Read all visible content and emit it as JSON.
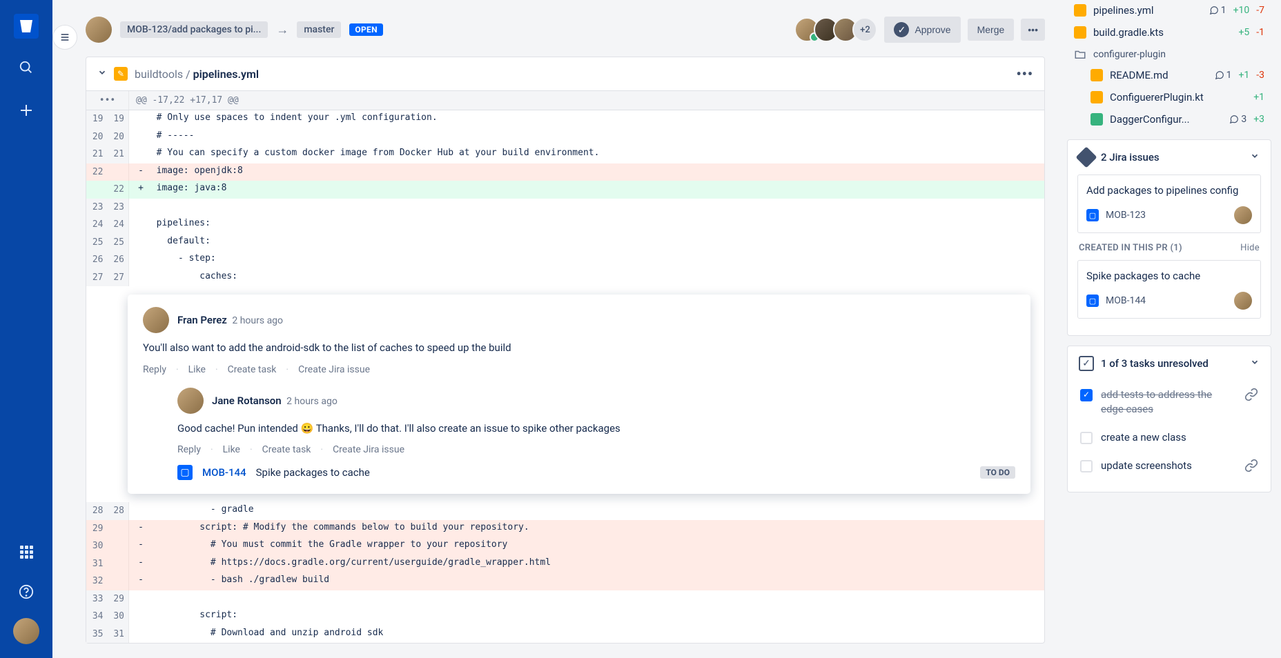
{
  "header": {
    "source_branch": "MOB-123/add packages to pi...",
    "target_branch": "master",
    "status": "OPEN",
    "overflow_count": "+2",
    "approve_label": "Approve",
    "merge_label": "Merge"
  },
  "file": {
    "path_prefix": "buildtools / ",
    "filename": "pipelines.yml",
    "hunk": "@@ -17,22 +17,17 @@"
  },
  "diff_lines": [
    {
      "old": "19",
      "new": "19",
      "type": "",
      "text": "  # Only use spaces to indent your .yml configuration."
    },
    {
      "old": "20",
      "new": "20",
      "type": "",
      "text": "  # -----"
    },
    {
      "old": "21",
      "new": "21",
      "type": "",
      "text": "  # You can specify a custom docker image from Docker Hub at your build environment."
    },
    {
      "old": "22",
      "new": "",
      "type": "del",
      "text": "  image: openjdk:8"
    },
    {
      "old": "",
      "new": "22",
      "type": "add",
      "text": "  image: java:8"
    },
    {
      "old": "23",
      "new": "23",
      "type": "",
      "text": ""
    },
    {
      "old": "24",
      "new": "24",
      "type": "",
      "text": "  pipelines:"
    },
    {
      "old": "25",
      "new": "25",
      "type": "",
      "text": "    default:"
    },
    {
      "old": "26",
      "new": "26",
      "type": "",
      "text": "      - step:"
    },
    {
      "old": "27",
      "new": "27",
      "type": "",
      "text": "          caches:"
    }
  ],
  "diff_lines_after": [
    {
      "old": "28",
      "new": "28",
      "type": "",
      "text": "            - gradle"
    },
    {
      "old": "29",
      "new": "",
      "type": "del",
      "text": "          script: # Modify the commands below to build your repository."
    },
    {
      "old": "30",
      "new": "",
      "type": "del",
      "text": "            # You must commit the Gradle wrapper to your repository"
    },
    {
      "old": "31",
      "new": "",
      "type": "del",
      "text": "            # https://docs.gradle.org/current/userguide/gradle_wrapper.html"
    },
    {
      "old": "32",
      "new": "",
      "type": "del",
      "text": "            - bash ./gradlew build"
    },
    {
      "old": "33",
      "new": "29",
      "type": "",
      "text": ""
    },
    {
      "old": "34",
      "new": "30",
      "type": "",
      "text": "          script:"
    },
    {
      "old": "35",
      "new": "31",
      "type": "",
      "text": "            # Download and unzip android sdk"
    }
  ],
  "comments": [
    {
      "author": "Fran Perez",
      "time": "2 hours ago",
      "body": "You'll also want to add the android-sdk to the list of caches to speed up the build",
      "actions": [
        "Reply",
        "Like",
        "Create task",
        "Create Jira issue"
      ]
    },
    {
      "author": "Jane Rotanson",
      "time": "2 hours ago",
      "body_before": "Good cache! Pun intended ",
      "body_after": " Thanks, I'll do that. I'll also create an issue to spike other packages",
      "emoji": "😀",
      "actions": [
        "Reply",
        "Like",
        "Create task",
        "Create Jira issue"
      ],
      "linked_key": "MOB-144",
      "linked_title": "Spike packages to cache",
      "linked_status": "TO DO"
    }
  ],
  "files_sidebar": [
    {
      "name": "pipelines.yml",
      "comments": "1",
      "added": "+10",
      "removed": "-7",
      "icon": "mod"
    },
    {
      "name": "build.gradle.kts",
      "comments": "",
      "added": "+5",
      "removed": "-1",
      "icon": "mod"
    }
  ],
  "folder": "configurer-plugin",
  "nested_files": [
    {
      "name": "README.md",
      "comments": "1",
      "added": "+1",
      "removed": "-3",
      "icon": "mod"
    },
    {
      "name": "ConfiguererPlugin.kt",
      "comments": "",
      "added": "+1",
      "removed": "",
      "icon": "mod"
    },
    {
      "name": "DaggerConfigur...",
      "comments": "3",
      "added": "+3",
      "removed": "",
      "icon": "new"
    }
  ],
  "jira_panel": {
    "title": "2 Jira issues",
    "issues": [
      {
        "title": "Add packages to pipelines config",
        "key": "MOB-123"
      }
    ],
    "created_title": "CREATED IN THIS PR (1)",
    "hide_label": "Hide",
    "created_issues": [
      {
        "title": "Spike packages to cache",
        "key": "MOB-144"
      }
    ]
  },
  "tasks_panel": {
    "title": "1 of 3 tasks unresolved",
    "tasks": [
      {
        "text": "add tests to address the edge cases",
        "done": true,
        "link": true
      },
      {
        "text": "create a new class",
        "done": false,
        "link": false
      },
      {
        "text": "update screenshots",
        "done": false,
        "link": true
      }
    ]
  }
}
